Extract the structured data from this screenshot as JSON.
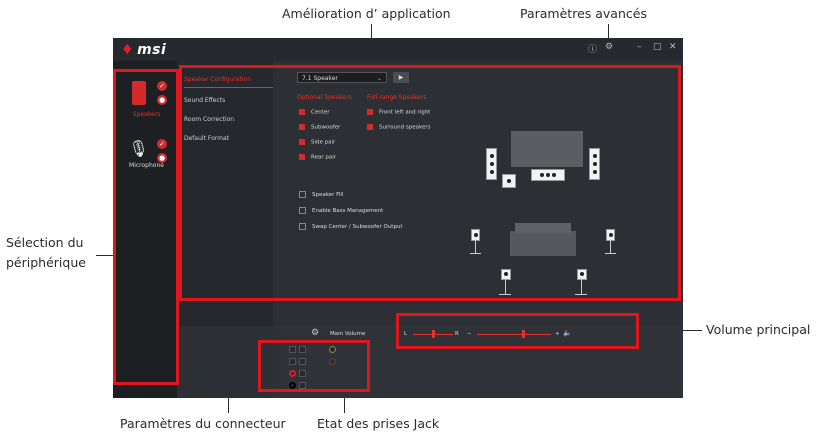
{
  "annotations": {
    "app_enhancement": "Amélioration d’ application",
    "advanced_settings": "Paramètres avancés",
    "device_selection_line1": "Sélection du",
    "device_selection_line2": "périphérique",
    "main_volume": "Volume principal",
    "connector_settings": "Paramètres du connecteur",
    "jack_status": "Etat des prises Jack"
  },
  "app": {
    "logo": "msi",
    "devices": [
      {
        "label": "Speakers",
        "icon": "speaker-icon"
      },
      {
        "label": "Microphone",
        "icon": "microphone-icon"
      }
    ],
    "menu": [
      "Speaker Configuration",
      "Sound Effects",
      "Room Correction",
      "Default Format"
    ],
    "speaker_config": {
      "selected": "7.1 Speaker",
      "optional_title": "Optional Speakers",
      "fullrange_title": "Full-range Speakers",
      "optional": [
        "Center",
        "Subwoofer",
        "Side pair",
        "Rear pair"
      ],
      "fullrange": [
        "Front left and right",
        "Surround speakers"
      ],
      "options": [
        "Speaker Fill",
        "Enable Bass Management",
        "Swap Center / Subwoofer Output"
      ]
    },
    "volume": {
      "label": "Main Volume",
      "left": "L",
      "right": "R",
      "minus": "−",
      "plus": "+",
      "level": 0.62,
      "balance": 0.5
    }
  },
  "colors": {
    "accent": "#e0161f",
    "app_bg": "#2c2f33"
  }
}
